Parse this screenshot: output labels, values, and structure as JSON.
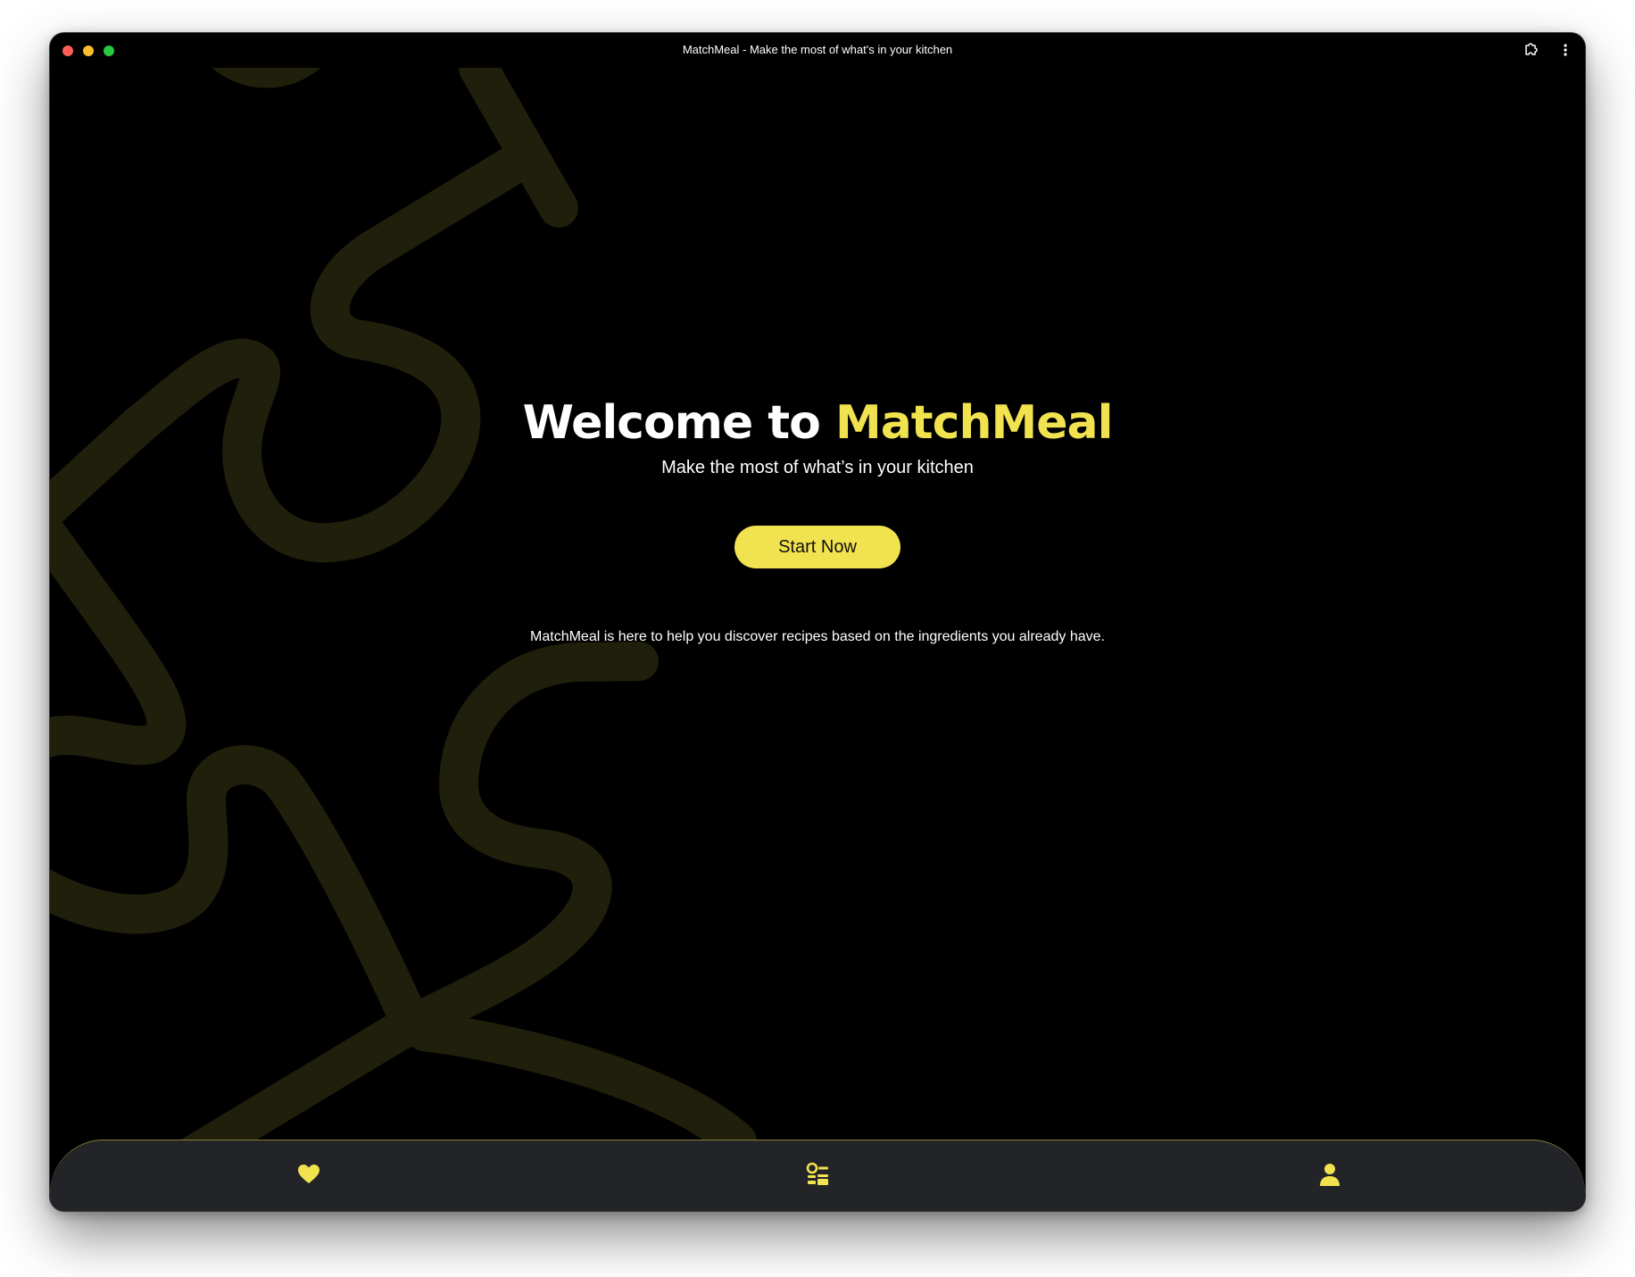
{
  "window": {
    "title": "MatchMeal - Make the most of what's in your kitchen",
    "traffic_lights": {
      "close": "#ff5f57",
      "minimize": "#febc2e",
      "maximize": "#28c840"
    },
    "toolbar_icons": [
      "extension-icon",
      "more-vertical-icon"
    ]
  },
  "hero": {
    "title_prefix": "Welcome to ",
    "title_brand": "MatchMeal",
    "subtitle": "Make the most of what’s in your kitchen",
    "cta_label": "Start Now",
    "description": "MatchMeal is here to help you discover recipes based on the ingredients you already have."
  },
  "bottom_nav": {
    "items": [
      {
        "icon": "heart-icon",
        "name": "favorites"
      },
      {
        "icon": "ingredients-list-icon",
        "name": "ingredients"
      },
      {
        "icon": "user-icon",
        "name": "profile"
      }
    ]
  },
  "colors": {
    "accent": "#f1e24f",
    "background": "#000000",
    "nav_background": "#232427",
    "decor_stroke": "#1f1f0c"
  }
}
